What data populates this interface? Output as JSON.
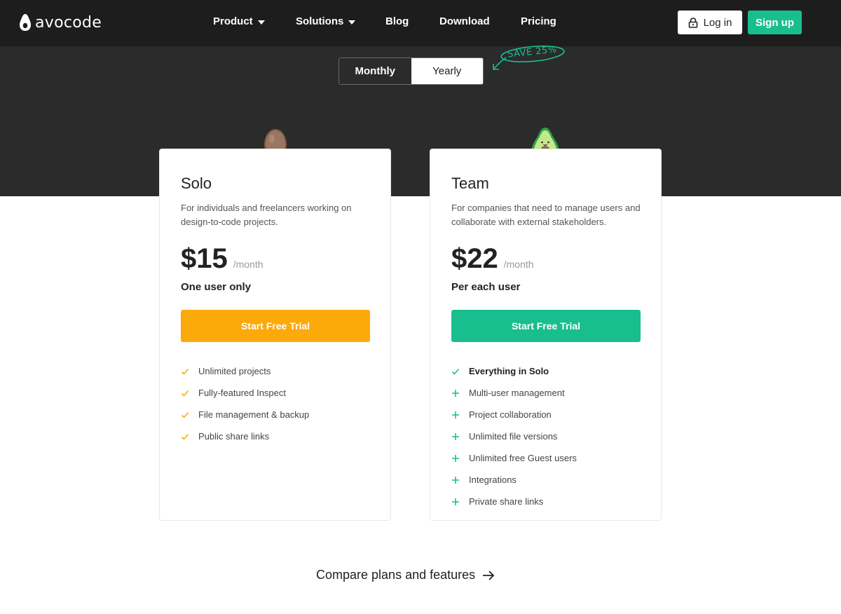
{
  "brand": {
    "name": "avocode",
    "accent": "#19be8f",
    "orange": "#fca90a"
  },
  "nav": {
    "items": [
      {
        "label": "Product",
        "dropdown": true
      },
      {
        "label": "Solutions",
        "dropdown": true
      },
      {
        "label": "Blog",
        "dropdown": false
      },
      {
        "label": "Download",
        "dropdown": false
      },
      {
        "label": "Pricing",
        "dropdown": false
      }
    ],
    "login_label": "Log in",
    "signup_label": "Sign up"
  },
  "billing": {
    "options": [
      "Monthly",
      "Yearly"
    ],
    "selected": "Monthly",
    "save_note": "SAVE 25%"
  },
  "plans": [
    {
      "name": "Solo",
      "description": "For individuals and freelancers working on design-to-code projects.",
      "price": "$15",
      "period": "/month",
      "note": "One user only",
      "cta": "Start Free Trial",
      "features": [
        {
          "text": "Unlimited projects",
          "icon": "check-icon"
        },
        {
          "text": "Fully-featured Inspect",
          "icon": "check-icon"
        },
        {
          "text": "File management & backup",
          "icon": "check-icon"
        },
        {
          "text": "Public share links",
          "icon": "check-icon"
        }
      ]
    },
    {
      "name": "Team",
      "description": "For companies that need to manage users and collaborate with external stakeholders.",
      "price": "$22",
      "period": "/month",
      "note": "Per each user",
      "cta": "Start Free Trial",
      "features": [
        {
          "text": "Everything in Solo",
          "icon": "check-icon"
        },
        {
          "text": "Multi-user management",
          "icon": "plus-icon"
        },
        {
          "text": "Project collaboration",
          "icon": "plus-icon"
        },
        {
          "text": "Unlimited file versions",
          "icon": "plus-icon"
        },
        {
          "text": "Unlimited free Guest users",
          "icon": "plus-icon"
        },
        {
          "text": "Integrations",
          "icon": "plus-icon"
        },
        {
          "text": "Private share links",
          "icon": "plus-icon"
        }
      ]
    }
  ],
  "compare_link": "Compare plans and features"
}
